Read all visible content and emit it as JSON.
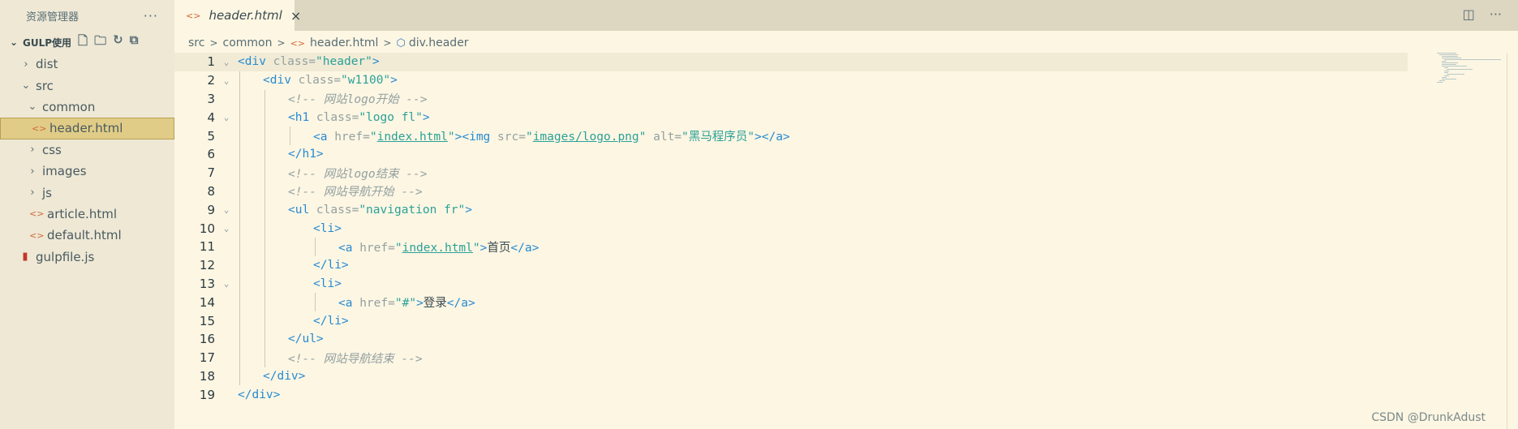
{
  "sidebar": {
    "title": "资源管理器",
    "more": "···",
    "project": "GULP使用",
    "items": [
      {
        "label": "dist",
        "type": "folder",
        "open": false,
        "depth": 1
      },
      {
        "label": "src",
        "type": "folder",
        "open": true,
        "depth": 1
      },
      {
        "label": "common",
        "type": "folder",
        "open": true,
        "depth": 2
      },
      {
        "label": "header.html",
        "type": "html",
        "depth": 3,
        "selected": true
      },
      {
        "label": "css",
        "type": "folder",
        "open": false,
        "depth": 2
      },
      {
        "label": "images",
        "type": "folder",
        "open": false,
        "depth": 2
      },
      {
        "label": "js",
        "type": "folder",
        "open": false,
        "depth": 2
      },
      {
        "label": "article.html",
        "type": "html",
        "depth": 2
      },
      {
        "label": "default.html",
        "type": "html",
        "depth": 2
      },
      {
        "label": "gulpfile.js",
        "type": "js",
        "depth": 1
      }
    ]
  },
  "tab": {
    "label": "header.html",
    "close": "×"
  },
  "breadcrumb": {
    "p1": "src",
    "p2": "common",
    "p3": "header.html",
    "p4": "div.header"
  },
  "editor": {
    "current_line": 1,
    "lines": [
      {
        "n": "1",
        "fold": true,
        "depth": 0,
        "tokens": [
          [
            "b",
            "<div "
          ],
          [
            "a",
            "class="
          ],
          [
            "g",
            "\"header\""
          ],
          [
            "b",
            ">"
          ]
        ]
      },
      {
        "n": "2",
        "fold": true,
        "depth": 1,
        "tokens": [
          [
            "b",
            "<div "
          ],
          [
            "a",
            "class="
          ],
          [
            "g",
            "\"w1100\""
          ],
          [
            "b",
            ">"
          ]
        ]
      },
      {
        "n": "3",
        "fold": false,
        "depth": 2,
        "tokens": [
          [
            "c",
            "<!-- 网站logo开始 -->"
          ]
        ]
      },
      {
        "n": "4",
        "fold": true,
        "depth": 2,
        "tokens": [
          [
            "b",
            "<h1 "
          ],
          [
            "a",
            "class="
          ],
          [
            "g",
            "\"logo fl\""
          ],
          [
            "b",
            ">"
          ]
        ]
      },
      {
        "n": "5",
        "fold": false,
        "depth": 3,
        "tokens": [
          [
            "b",
            "<a "
          ],
          [
            "a",
            "href="
          ],
          [
            "g",
            "\""
          ],
          [
            "u",
            "index.html"
          ],
          [
            "g",
            "\""
          ],
          [
            "b",
            "><img "
          ],
          [
            "a",
            "src="
          ],
          [
            "g",
            "\""
          ],
          [
            "u",
            "images/logo.png"
          ],
          [
            "g",
            "\""
          ],
          [
            "a",
            " alt="
          ],
          [
            "g",
            "\"黑马程序员\""
          ],
          [
            "b",
            "></a>"
          ]
        ]
      },
      {
        "n": "6",
        "fold": false,
        "depth": 2,
        "tokens": [
          [
            "b",
            "</h1>"
          ]
        ]
      },
      {
        "n": "7",
        "fold": false,
        "depth": 2,
        "tokens": [
          [
            "c",
            "<!-- 网站logo结束 -->"
          ]
        ]
      },
      {
        "n": "8",
        "fold": false,
        "depth": 2,
        "tokens": [
          [
            "c",
            "<!-- 网站导航开始 -->"
          ]
        ]
      },
      {
        "n": "9",
        "fold": true,
        "depth": 2,
        "tokens": [
          [
            "b",
            "<ul "
          ],
          [
            "a",
            "class="
          ],
          [
            "g",
            "\"navigation fr\""
          ],
          [
            "b",
            ">"
          ]
        ]
      },
      {
        "n": "10",
        "fold": true,
        "depth": 3,
        "tokens": [
          [
            "b",
            "<li>"
          ]
        ]
      },
      {
        "n": "11",
        "fold": false,
        "depth": 4,
        "tokens": [
          [
            "b",
            "<a "
          ],
          [
            "a",
            "href="
          ],
          [
            "g",
            "\""
          ],
          [
            "u",
            "index.html"
          ],
          [
            "g",
            "\""
          ],
          [
            "b",
            ">"
          ],
          [
            "t",
            "首页"
          ],
          [
            "b",
            "</a>"
          ]
        ]
      },
      {
        "n": "12",
        "fold": false,
        "depth": 3,
        "tokens": [
          [
            "b",
            "</li>"
          ]
        ]
      },
      {
        "n": "13",
        "fold": true,
        "depth": 3,
        "tokens": [
          [
            "b",
            "<li>"
          ]
        ]
      },
      {
        "n": "14",
        "fold": false,
        "depth": 4,
        "tokens": [
          [
            "b",
            "<a "
          ],
          [
            "a",
            "href="
          ],
          [
            "g",
            "\"#\""
          ],
          [
            "b",
            ">"
          ],
          [
            "t",
            "登录"
          ],
          [
            "b",
            "</a>"
          ]
        ]
      },
      {
        "n": "15",
        "fold": false,
        "depth": 3,
        "tokens": [
          [
            "b",
            "</li>"
          ]
        ]
      },
      {
        "n": "16",
        "fold": false,
        "depth": 2,
        "tokens": [
          [
            "b",
            "</ul>"
          ]
        ]
      },
      {
        "n": "17",
        "fold": false,
        "depth": 2,
        "tokens": [
          [
            "c",
            "<!-- 网站导航结束 -->"
          ]
        ]
      },
      {
        "n": "18",
        "fold": false,
        "depth": 1,
        "tokens": [
          [
            "b",
            "</div>"
          ]
        ]
      },
      {
        "n": "19",
        "fold": false,
        "depth": 0,
        "tokens": [
          [
            "b",
            "</div>"
          ]
        ]
      }
    ]
  },
  "watermark": "CSDN @DrunkAdust"
}
